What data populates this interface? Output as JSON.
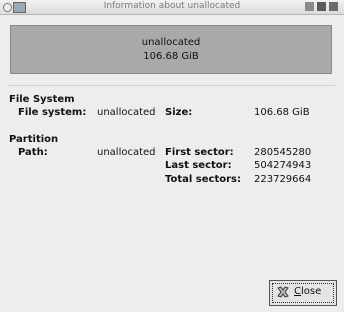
{
  "window": {
    "title": "Information about unallocated"
  },
  "partition_box": {
    "name": "unallocated",
    "size": "106.68 GiB"
  },
  "file_system": {
    "heading": "File System",
    "fs_label": "File system:",
    "fs_value": "unallocated",
    "size_label": "Size:",
    "size_value": "106.68 GiB"
  },
  "partition": {
    "heading": "Partition",
    "path_label": "Path:",
    "path_value": "unallocated",
    "first_label": "First sector:",
    "first_value": "280545280",
    "last_label": "Last sector:",
    "last_value": "504274943",
    "total_label": "Total sectors:",
    "total_value": "223729664"
  },
  "close_button": {
    "mnemonic": "C",
    "rest": "lose"
  },
  "colors": {
    "partition_fill": "#a9a9a9",
    "window_bg": "#ededed"
  }
}
